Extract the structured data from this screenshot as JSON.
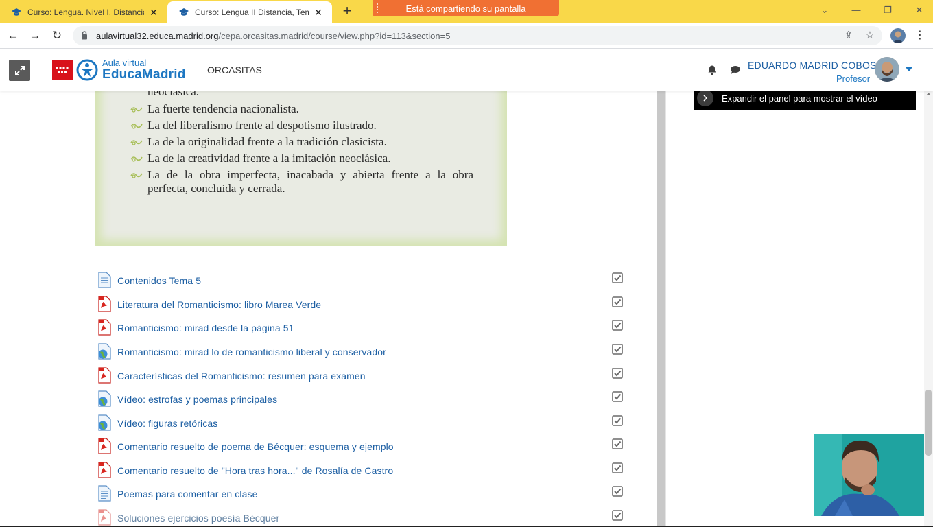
{
  "browser": {
    "tabs": [
      {
        "title": "Curso: Lengua. Nivel I. Distancia",
        "active": false
      },
      {
        "title": "Curso: Lengua II Distancia, Tema",
        "active": true
      }
    ],
    "share_banner": "Está compartiendo su pantalla",
    "url_domain": "aulavirtual32.educa.madrid.org",
    "url_path": "/cepa.orcasitas.madrid/course/view.php?id=113&section=5"
  },
  "header": {
    "logo_top": "Aula virtual",
    "logo_main": "EducaMadrid",
    "site_name": "ORCASITAS",
    "user_name": "EDUARDO MADRID COBOS",
    "user_role": "Profesor"
  },
  "book_excerpt": {
    "lines": [
      "neoclásica.",
      "La fuerte tendencia nacionalista.",
      "La del liberalismo frente al despotismo ilustrado.",
      "La de la originalidad frente a la tradición clasicista.",
      "La de la creatividad frente a la imitación neoclásica.",
      "La de la obra imperfecta, inacabada y abierta frente a la obra perfecta, concluida y cerrada."
    ]
  },
  "activities": [
    {
      "label": "Contenidos Tema 5",
      "icon": "page-icon"
    },
    {
      "label": "Literatura del Romanticismo: libro Marea Verde",
      "icon": "pdf-icon"
    },
    {
      "label": "Romanticismo: mirad desde la página 51",
      "icon": "pdf-icon"
    },
    {
      "label": "Romanticismo: mirad lo de romanticismo liberal y conservador",
      "icon": "url-icon"
    },
    {
      "label": "Características del Romanticismo: resumen para examen",
      "icon": "pdf-icon"
    },
    {
      "label": "Vídeo: estrofas y poemas principales",
      "icon": "url-icon"
    },
    {
      "label": "Vídeo: figuras retóricas",
      "icon": "url-icon"
    },
    {
      "label": "Comentario resuelto de poema de Bécquer: esquema y ejemplo",
      "icon": "pdf-icon"
    },
    {
      "label": "Comentario resuelto de \"Hora tras hora...\" de Rosalía de Castro",
      "icon": "pdf-icon"
    },
    {
      "label": "Poemas para comentar en clase",
      "icon": "page-icon"
    },
    {
      "label": "Soluciones ejercicios poesía Bécquer",
      "icon": "pdf-icon"
    }
  ],
  "video_tooltip": "Expandir el panel para mostrar el vídeo",
  "colors": {
    "tabbar": "#f9d849",
    "share_banner": "#f07033",
    "link": "#1d5fa3",
    "brand": "#1d77c2"
  }
}
